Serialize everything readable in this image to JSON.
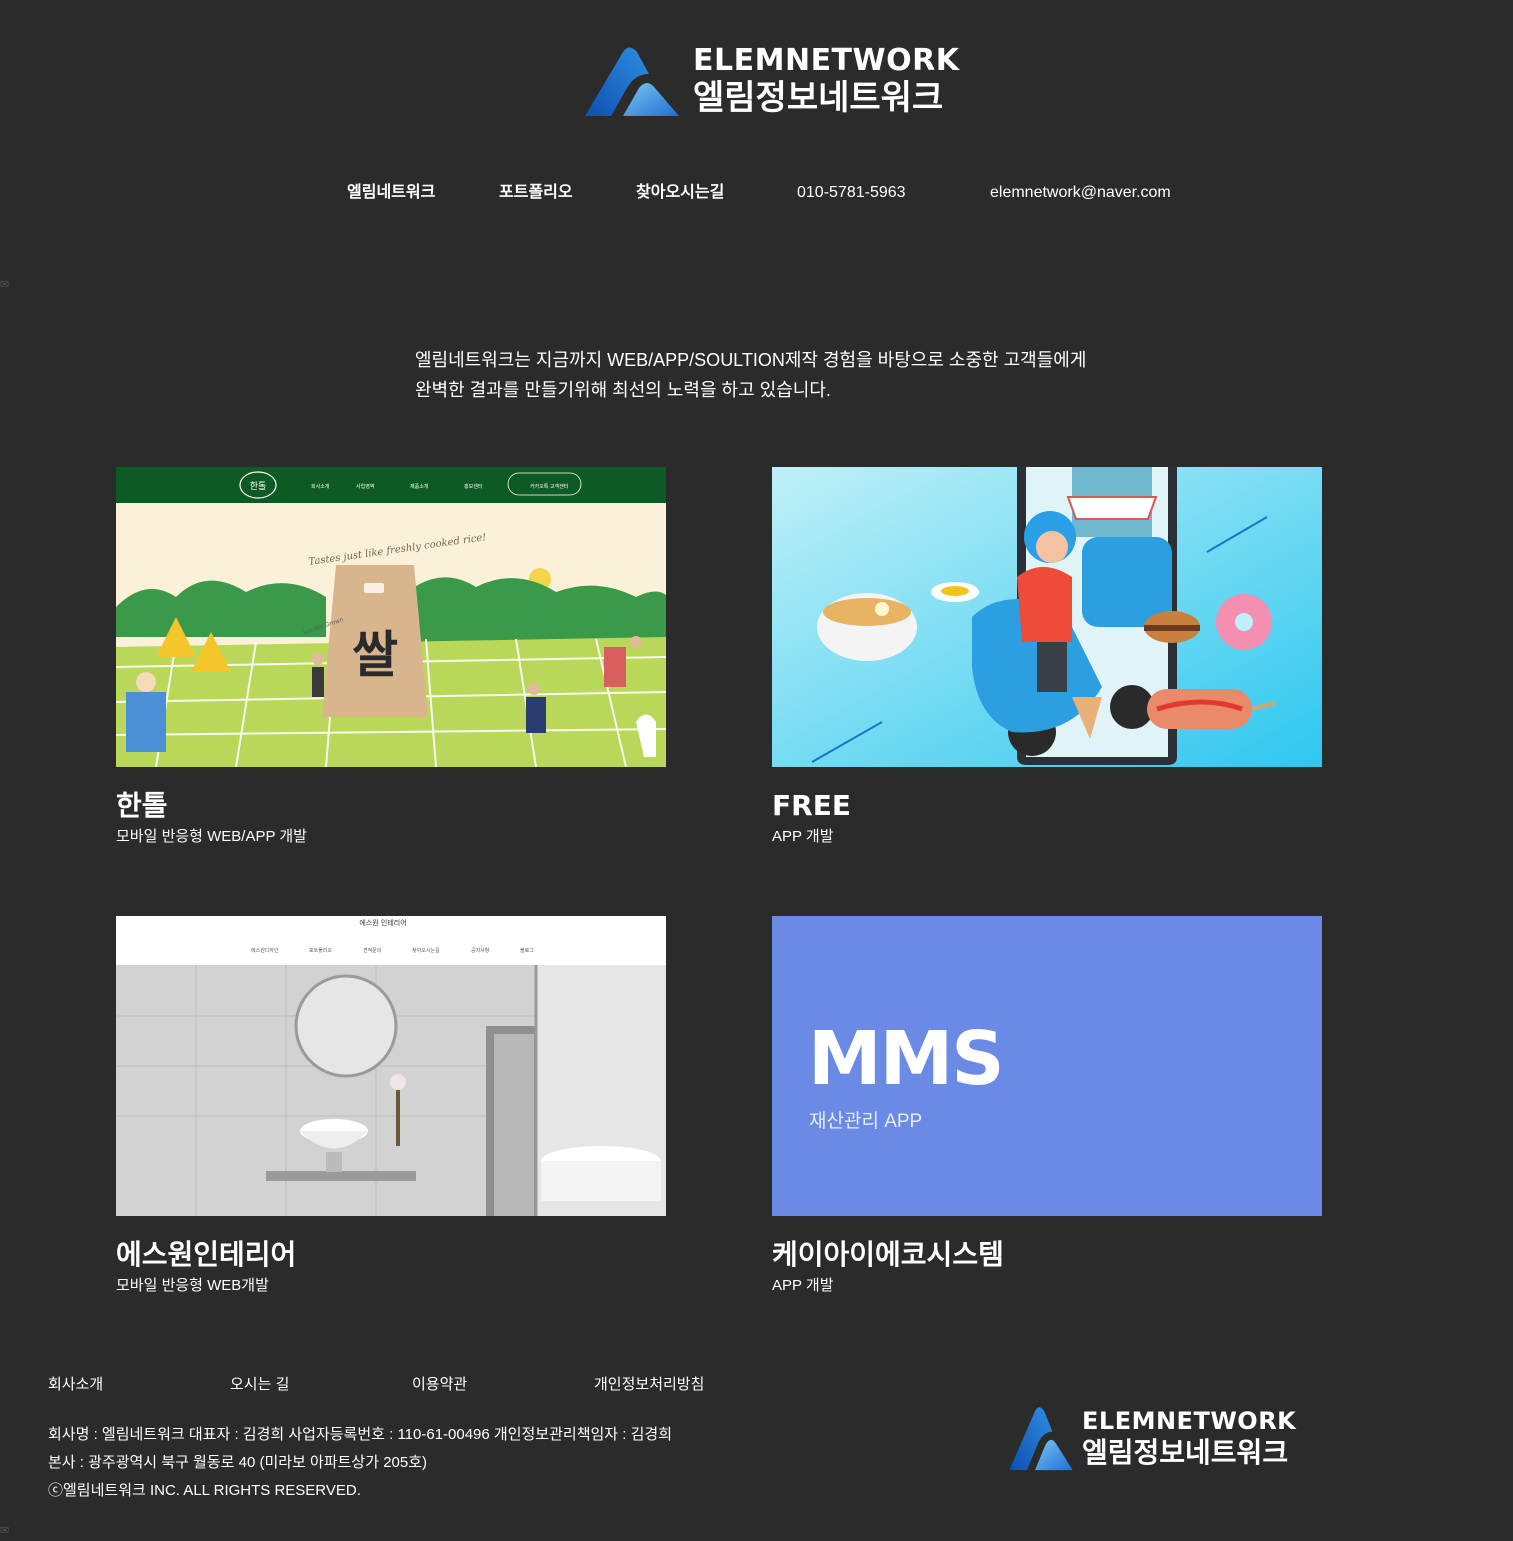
{
  "header": {
    "logo": {
      "en": "ELEMNETWORK",
      "ko": "엘림정보네트워크"
    },
    "nav": [
      {
        "label": "엘림네트워크"
      },
      {
        "label": "포트폴리오"
      },
      {
        "label": "찾아오시는길"
      },
      {
        "label": "010-5781-5963"
      },
      {
        "label": "elemnetwork@naver.com"
      }
    ]
  },
  "intro": {
    "line1": "엘림네트워크는 지금까지 WEB/APP/SOULTION제작 경험을 바탕으로 소중한 고객들에게",
    "line2": "완벽한 결과를 만들기위해 최선의 노력을 하고 있습니다."
  },
  "portfolio": [
    {
      "title": "한톨",
      "subtitle": "모바일 반응형 WEB/APP 개발",
      "thumb": {
        "nav": [
          "회사소개",
          "사업영역",
          "제품소개",
          "홍보센터",
          "카카오톡 고객센터"
        ],
        "tagline": "Tastes just like freshly cooked rice!",
        "bag_text": "쌀",
        "bag_brand": "한톨",
        "stamp": "Locally Grown"
      }
    },
    {
      "title": "FREE",
      "subtitle": "APP 개발"
    },
    {
      "title": "에스원인테리어",
      "subtitle": "모바일 반응형 WEB개발",
      "thumb": {
        "brand": "에스원 인테리어",
        "nav": [
          "에스원디자인",
          "포트폴리오",
          "견적문의",
          "찾아오시는길",
          "공지사항",
          "블로그"
        ]
      }
    },
    {
      "title": "케이아이에코시스템",
      "subtitle": "APP 개발",
      "thumb": {
        "big": "MMS",
        "small": "재산관리 APP"
      }
    }
  ],
  "footer": {
    "links": [
      "회사소개",
      "오시는 길",
      "이용약관",
      "개인정보처리방침"
    ],
    "info": [
      "회사명 : 엘림네트워크 대표자 : 김경희 사업자등록번호 : 110-61-00496 개인정보관리책임자 : 김경희",
      "본사 : 광주광역시 북구 월동로 40 (미라보 아파트상가 205호)",
      "ⓒ엘림네트워크 INC. ALL RIGHTS RESERVED."
    ],
    "logo": {
      "en": "ELEMNETWORK",
      "ko": "엘림정보네트워크"
    }
  },
  "colors": {
    "background": "#2b2b2b",
    "logo_blue": "#1a64c8",
    "logo_light": "#5fb6ef",
    "mms_bg": "#6b8ae6",
    "hantol_header": "#0d5a24"
  }
}
